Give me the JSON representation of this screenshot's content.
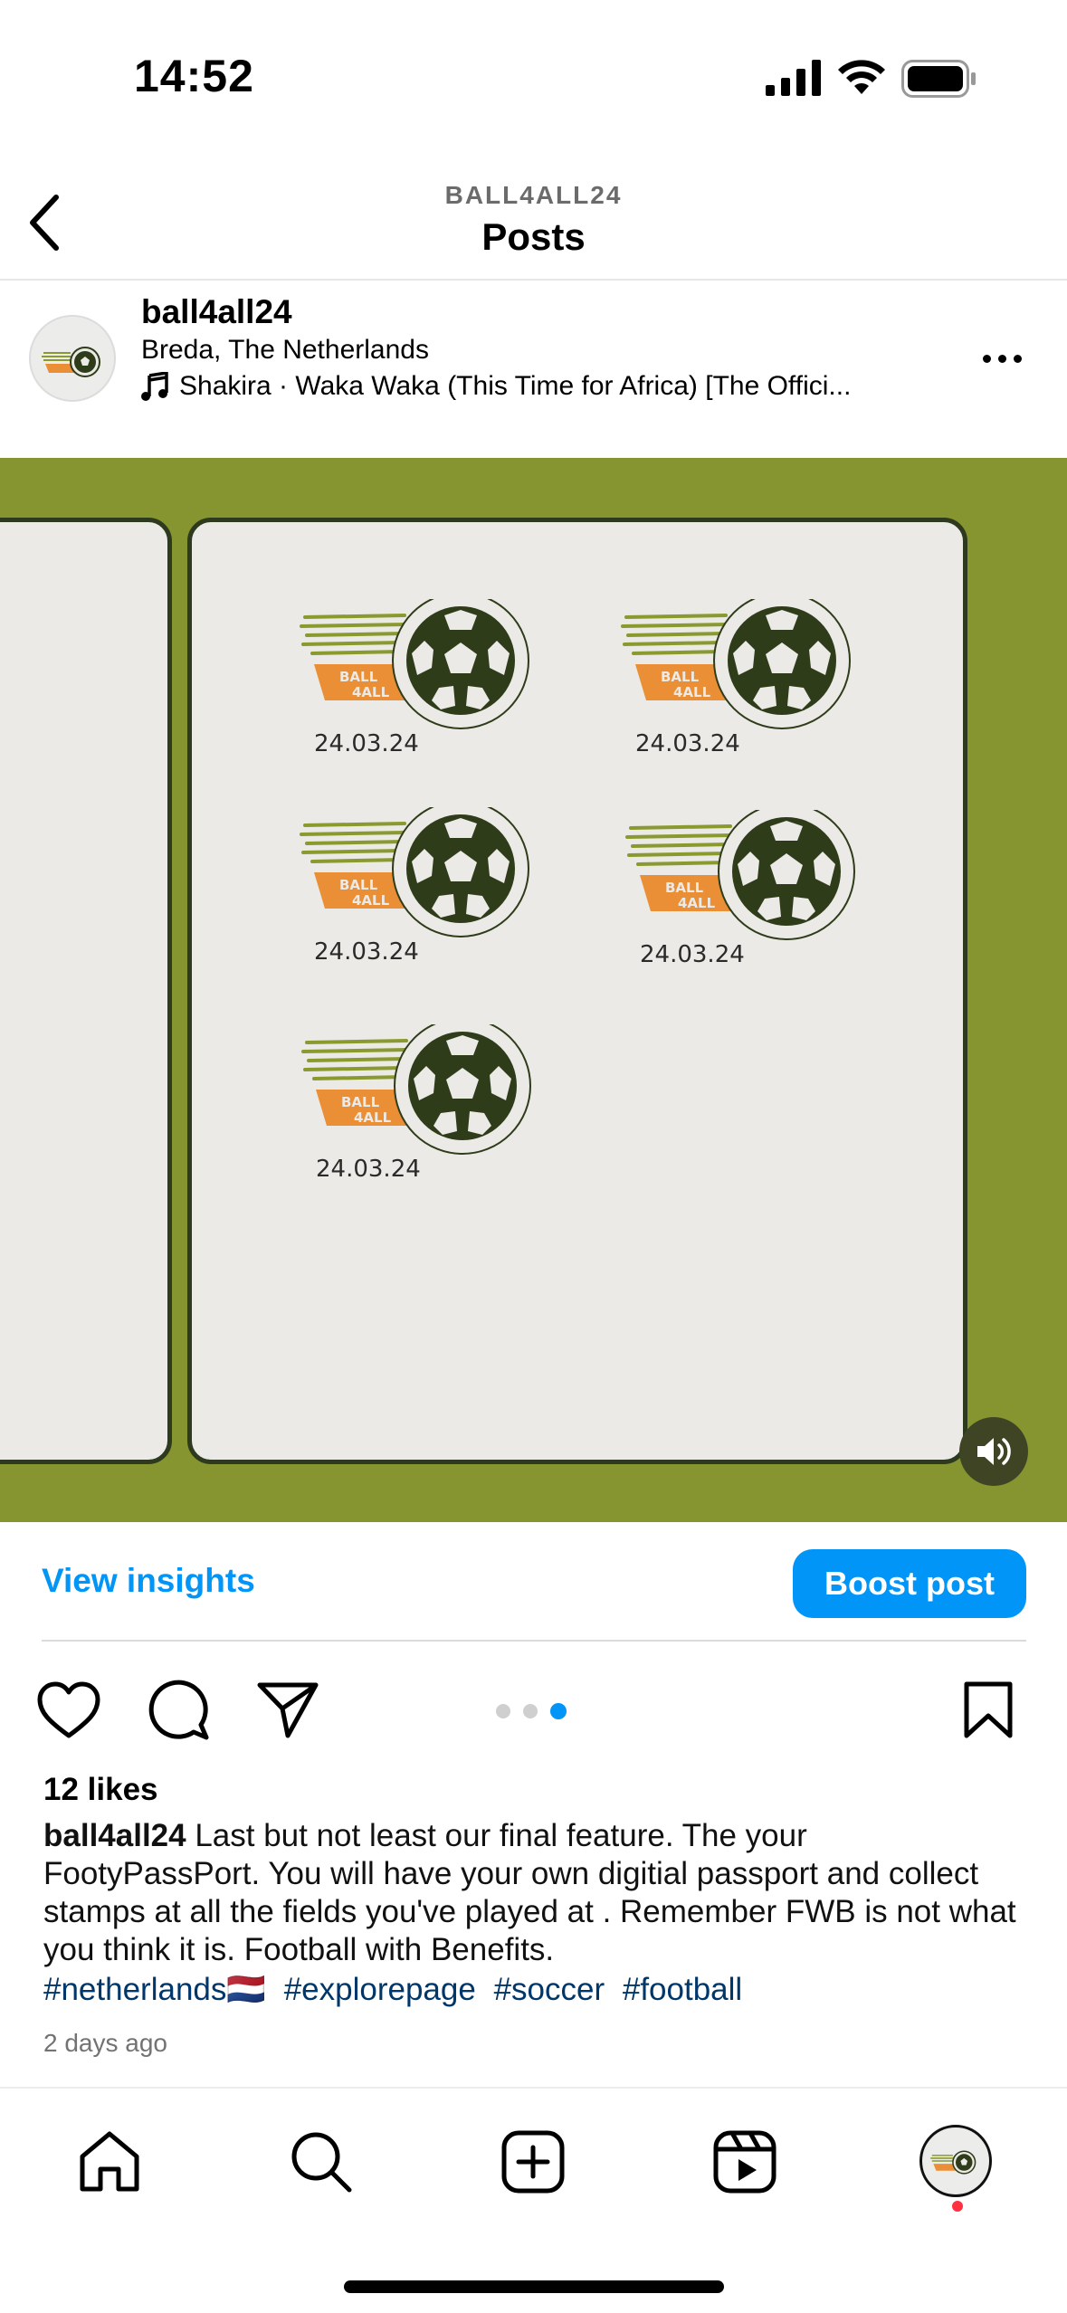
{
  "status_bar": {
    "time": "14:52"
  },
  "header": {
    "account": "BALL4ALL24",
    "title": "Posts"
  },
  "post": {
    "username": "ball4all24",
    "location": "Breda, The Netherlands",
    "music": "Shakira · Waka Waka (This Time for Africa) [The Offici...",
    "stamps": [
      {
        "logo_text": "BALL 4ALL",
        "date": "24.03.24"
      },
      {
        "logo_text": "BALL 4ALL",
        "date": "24.03.24"
      },
      {
        "logo_text": "BALL 4ALL",
        "date": "24.03.24"
      },
      {
        "logo_text": "BALL 4ALL",
        "date": "24.03.24"
      },
      {
        "logo_text": "BALL 4ALL",
        "date": "24.03.24"
      }
    ],
    "carousel": {
      "total": 3,
      "active": 3
    }
  },
  "actions": {
    "view_insights": "View insights",
    "boost_post": "Boost post"
  },
  "likes": "12 likes",
  "caption": {
    "user": "ball4all24",
    "text": " Last but not least our final feature. The your FootyPassPort. You will have your own digitial passport and collect stamps at all the fields you've played at . Remember FWB is not what you think it is. Football with Benefits.",
    "hashtags": [
      "#netherlands🇳🇱",
      "#explorepage",
      "#soccer",
      "#football"
    ]
  },
  "time_ago": "2 days ago",
  "colors": {
    "accent": "#0095f6",
    "media_bg": "#879530",
    "card_bg": "#ebeae6",
    "card_border": "#2d3a1d",
    "logo_orange": "#ea8f35",
    "logo_green": "#8a9a2e",
    "ball_dark": "#2f3c1a"
  }
}
